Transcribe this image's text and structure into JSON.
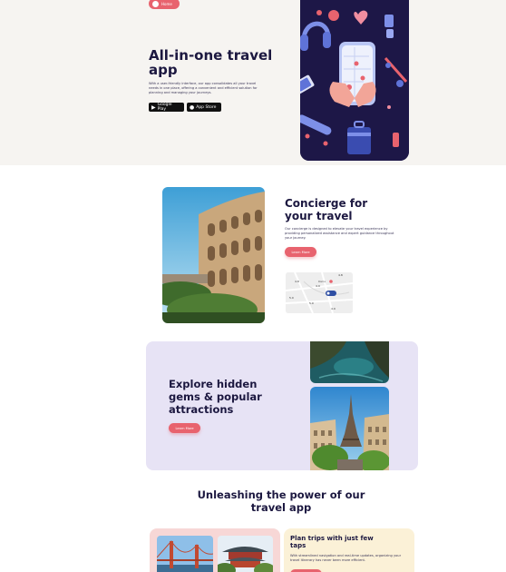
{
  "hero": {
    "pill_label": "Home",
    "title": "All-in-one travel app",
    "description": "With a user-friendly interface, our app consolidates all your travel needs in one place, offering a convenient and efficient solution for planning and managing your journeys.",
    "google_play_label": "Google Play",
    "app_store_label": "App Store"
  },
  "concierge": {
    "title": "Concierge for your travel",
    "description": "Our concierge is designed to elevate your travel experience by providing personalized assistance and expert guidance throughout your journey.",
    "button_label": "Learn More",
    "map": {
      "label_1": "4.8",
      "label_2": "4.8",
      "label_3": "4.9",
      "label_4": "5.0",
      "label_5": "4.9",
      "label_6": "5.0",
      "city": "Roma"
    }
  },
  "explore": {
    "title": "Explore hidden gems & popular attractions",
    "button_label": "Learn More"
  },
  "power": {
    "title": "Unleashing the power of our travel app"
  },
  "plan": {
    "title": "Plan trips with just few taps",
    "description": "With streamlined navigation and real-time updates, organizing your travel itinerary has never been more efficient."
  },
  "colors": {
    "accent": "#e8636e",
    "navy": "#1c1840",
    "hero_bg": "#f6f4f1",
    "explore_bg": "#e7e3f5",
    "card_pink": "#f7d7d6",
    "card_yellow": "#fbf1d7"
  }
}
